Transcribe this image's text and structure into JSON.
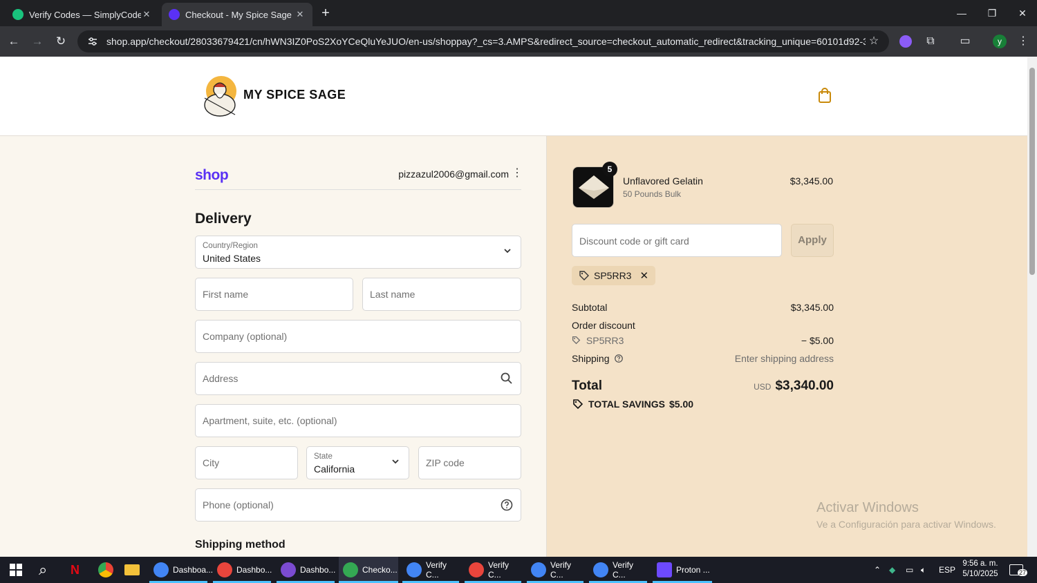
{
  "browser": {
    "tabs": [
      {
        "title": "Verify Codes — SimplyCodes",
        "active": false,
        "favicon_color": "#19c37d"
      },
      {
        "title": "Checkout - My Spice Sage",
        "active": true,
        "favicon_color": "#5a31f4"
      }
    ],
    "url": "shop.app/checkout/28033679421/cn/hWN3IZ0PoS2XoYCeQluYeJUO/en-us/shoppay?_cs=3.AMPS&redirect_source=checkout_automatic_redirect&tracking_unique=60101d92-3b3f-4697-b...",
    "profile_initial": "y"
  },
  "store": {
    "name": "MY SPICE SAGE"
  },
  "account": {
    "email": "pizzazul2006@gmail.com",
    "shop_logo": "shop"
  },
  "delivery": {
    "heading": "Delivery",
    "country": {
      "label": "Country/Region",
      "value": "United States"
    },
    "first_name": {
      "placeholder": "First name"
    },
    "last_name": {
      "placeholder": "Last name"
    },
    "company": {
      "placeholder": "Company (optional)"
    },
    "address": {
      "placeholder": "Address"
    },
    "apartment": {
      "placeholder": "Apartment, suite, etc. (optional)"
    },
    "city": {
      "placeholder": "City"
    },
    "state": {
      "label": "State",
      "value": "California"
    },
    "zip": {
      "placeholder": "ZIP code"
    },
    "phone": {
      "placeholder": "Phone (optional)"
    },
    "shipping_method_heading": "Shipping method"
  },
  "summary": {
    "product": {
      "name": "Unflavored Gelatin",
      "variant": "50 Pounds Bulk",
      "price": "$3,345.00",
      "quantity": "5"
    },
    "discount_placeholder": "Discount code or gift card",
    "apply_label": "Apply",
    "applied_code": "SP5RR3",
    "subtotal_label": "Subtotal",
    "subtotal_value": "$3,345.00",
    "order_discount_label": "Order discount",
    "discount_code": "SP5RR3",
    "discount_value": "− $5.00",
    "shipping_label": "Shipping",
    "shipping_value": "Enter shipping address",
    "total_label": "Total",
    "total_currency": "USD",
    "total_value": "$3,340.00",
    "savings_label": "TOTAL SAVINGS",
    "savings_value": "$5.00"
  },
  "watermark": {
    "line1": "Activar Windows",
    "line2": "Ve a Configuración para activar Windows."
  },
  "taskbar": {
    "apps": [
      {
        "label": "Dashboa...",
        "color": "#4285f4"
      },
      {
        "label": "Dashbo...",
        "color": "#e8453c"
      },
      {
        "label": "Dashbo...",
        "color": "#7b4bd1"
      },
      {
        "label": "Checko...",
        "color": "#34a853"
      },
      {
        "label": "Verify C...",
        "color": "#4285f4"
      },
      {
        "label": "Verify C...",
        "color": "#e8453c"
      },
      {
        "label": "Verify C...",
        "color": "#4285f4"
      },
      {
        "label": "Verify C...",
        "color": "#4285f4"
      },
      {
        "label": "Proton ...",
        "color": "#6d4aff"
      }
    ],
    "language": "ESP",
    "time": "9:56 a. m.",
    "date": "5/10/2025",
    "notifications": "27"
  }
}
